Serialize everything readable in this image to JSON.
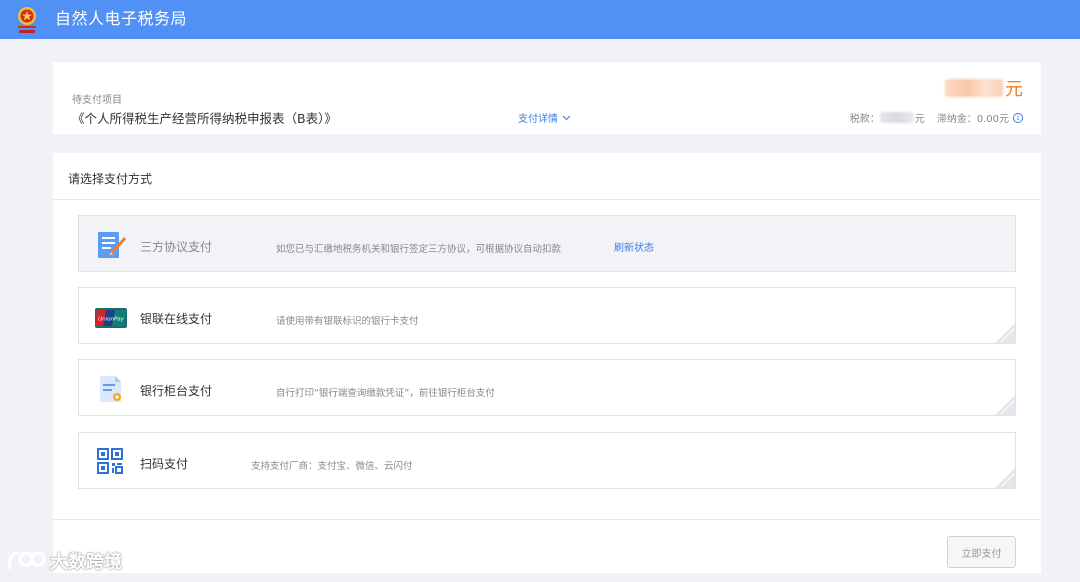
{
  "header": {
    "title": "自然人电子税务局"
  },
  "pending": {
    "label": "待支付项目",
    "name": "《个人所得税生产经营所得纳税申报表（B表）》",
    "detail_link": "支付详情",
    "amount_unit": "元",
    "tax_prefix": "税款：",
    "tax_unit": "元",
    "late_fee_text": "滞纳金：0.00元"
  },
  "methods": {
    "title": "请选择支付方式",
    "items": [
      {
        "label": "三方协议支付",
        "desc": "如您已与汇缴地税务机关和银行签定三方协议，可根据协议自动扣款",
        "link": "刷新状态"
      },
      {
        "label": "银联在线支付",
        "desc": "请使用带有银联标识的银行卡支付"
      },
      {
        "label": "银行柜台支付",
        "desc": "自行打印“银行端查询缴款凭证”，前往银行柜台支付"
      },
      {
        "label": "扫码支付",
        "desc": "支持支付厂商：支付宝、微信、云闪付"
      }
    ],
    "pay_button": "立即支付"
  },
  "watermark": {
    "text": "大数跨境"
  },
  "colors": {
    "header_bg": "#5190f5",
    "accent_link": "#3a7ee8",
    "amount_orange": "#f47a1b"
  },
  "icons": {
    "emblem": "national-tax-emblem-icon",
    "agreement": "document-pen-icon",
    "unionpay": "unionpay-card-icon",
    "counter": "document-stamp-icon",
    "qr": "qr-code-icon"
  }
}
